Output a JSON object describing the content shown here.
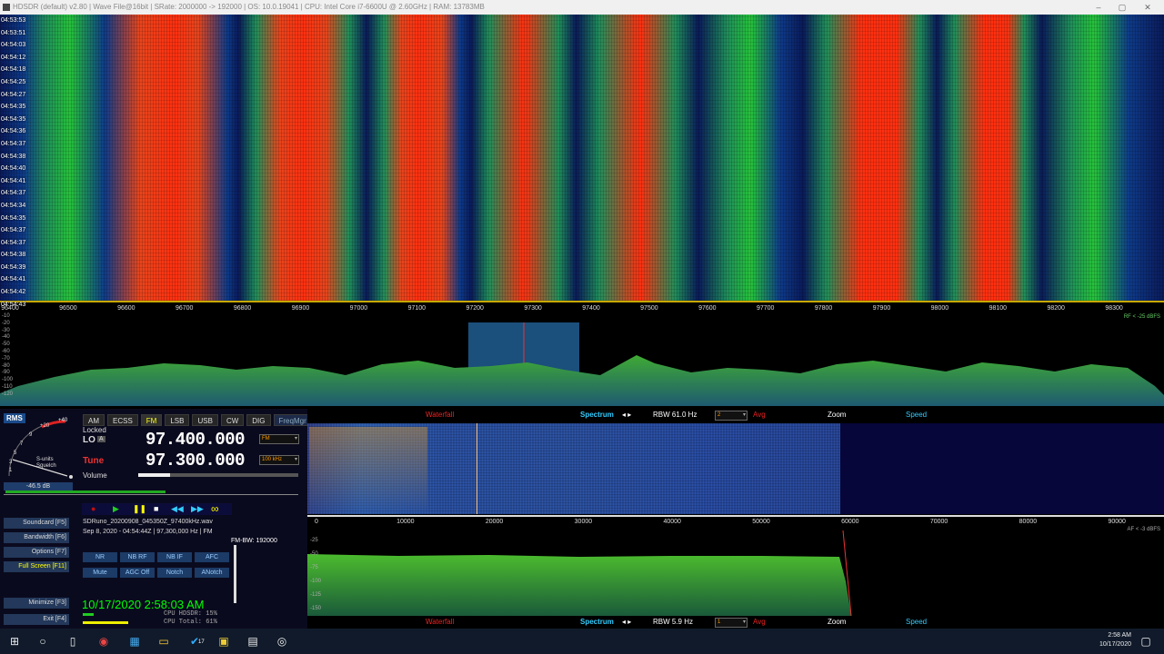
{
  "window": {
    "title": "HDSDR  (default)  v2.80   |   Wave File@16bit   |   SRate: 2000000 -> 192000   |   OS: 10.0.19041   |   CPU: Intel Core i7-6600U @ 2.60GHz   |   RAM: 13783MB",
    "minimize": "–",
    "maximize": "▢",
    "close": "✕"
  },
  "waterfall_times": [
    "04:53:53",
    "04:53:51",
    "04:54:03",
    "04:54:12",
    "04:54:18",
    "04:54:25",
    "04:54:27",
    "04:54:35",
    "04:54:35",
    "04:54:36",
    "04:54:37",
    "04:54:38",
    "04:54:40",
    "04:54:41",
    "04:54:37",
    "04:54:34",
    "04:54:35",
    "04:54:37",
    "04:54:37",
    "04:54:38",
    "04:54:39",
    "04:54:41",
    "04:54:42",
    "04:54:43"
  ],
  "freq_axis": [
    "96400",
    "96500",
    "96600",
    "96700",
    "96800",
    "96900",
    "97000",
    "97100",
    "97200",
    "97300",
    "97400",
    "97500",
    "97600",
    "97700",
    "97800",
    "97900",
    "98000",
    "98100",
    "98200",
    "98300"
  ],
  "main_spectrum": {
    "db_labels": [
      "-10",
      "-20",
      "-30",
      "-40",
      "-50",
      "-60",
      "-70",
      "-80",
      "-90",
      "-100",
      "-110",
      "-120"
    ],
    "rf_note": "RF < -25 dBFS"
  },
  "controls": {
    "rms_label": "RMS",
    "meter_scale": [
      "1",
      "3",
      "5",
      "7",
      "9",
      "+20",
      "+40"
    ],
    "meter_sunits": "S-units",
    "meter_squelch": "Squelch",
    "modes": [
      "AM",
      "ECSS",
      "FM",
      "LSB",
      "USB",
      "CW",
      "DIG"
    ],
    "active_mode": "FM",
    "freqmgr": "FreqMgr",
    "locked": "Locked",
    "lo_label": "LO",
    "lo_a": "A",
    "lo_freq": "97.400.000",
    "lo_mode": "FM",
    "tune_label": "Tune",
    "tune_freq": "97.300.000",
    "tune_step": "100 kHz",
    "volume_label": "Volume",
    "level_readout": "-46.5 dB",
    "player_icons": [
      "●",
      "▶",
      "❚❚",
      "■",
      "◀◀",
      "▶▶",
      "∞"
    ],
    "file_name": "SDRuno_20200908_045350Z_97400kHz.wav",
    "file_info": "Sep 8, 2020 - 04:54:44Z | 97,300,000 Hz | FM",
    "fm_bw": "FM-BW: 192000",
    "side_buttons": [
      "Soundcard  [F5]",
      "Bandwidth  [F6]",
      "Options  [F7]",
      "Full Screen  [F11]",
      "Minimize  [F3]",
      "Exit  [F4]"
    ],
    "dsp_row1": [
      "NR",
      "NB RF",
      "NB IF",
      "AFC"
    ],
    "dsp_row2": [
      "Mute",
      "AGC Off",
      "Notch",
      "ANotch"
    ],
    "clock": "10/17/2020 2:58:03 AM",
    "cpu_hdsdr": "CPU HDSDR: 15%",
    "cpu_total": "CPU Total: 61%"
  },
  "toolbar_top": {
    "waterfall": "Waterfall",
    "spectrum": "Spectrum",
    "rbw": "RBW 61.0 Hz",
    "avg_value": "2",
    "avg": "Avg",
    "zoom": "Zoom",
    "speed": "Speed"
  },
  "sub_axis": [
    "0",
    "10000",
    "20000",
    "30000",
    "40000",
    "50000",
    "60000",
    "70000",
    "80000",
    "90000"
  ],
  "sub_spectrum": {
    "db_labels": [
      "-25",
      "-50",
      "-75",
      "-100",
      "-125",
      "-150"
    ],
    "af_note": "AF < -3 dBFS"
  },
  "toolbar_bottom": {
    "waterfall": "Waterfall",
    "spectrum": "Spectrum",
    "rbw": "RBW  5.9 Hz",
    "avg_value": "1",
    "avg": "Avg",
    "zoom": "Zoom",
    "speed": "Speed"
  },
  "taskbar": {
    "time": "2:58 AM",
    "date": "10/17/2020",
    "badge": "17"
  },
  "colors": {
    "waterfall_red": "#ff3010",
    "waterfall_green": "#25c33a",
    "waterfall_blue": "#0e3b8a",
    "accent_cyan": "#3cf",
    "clock_green": "#00ff00"
  }
}
